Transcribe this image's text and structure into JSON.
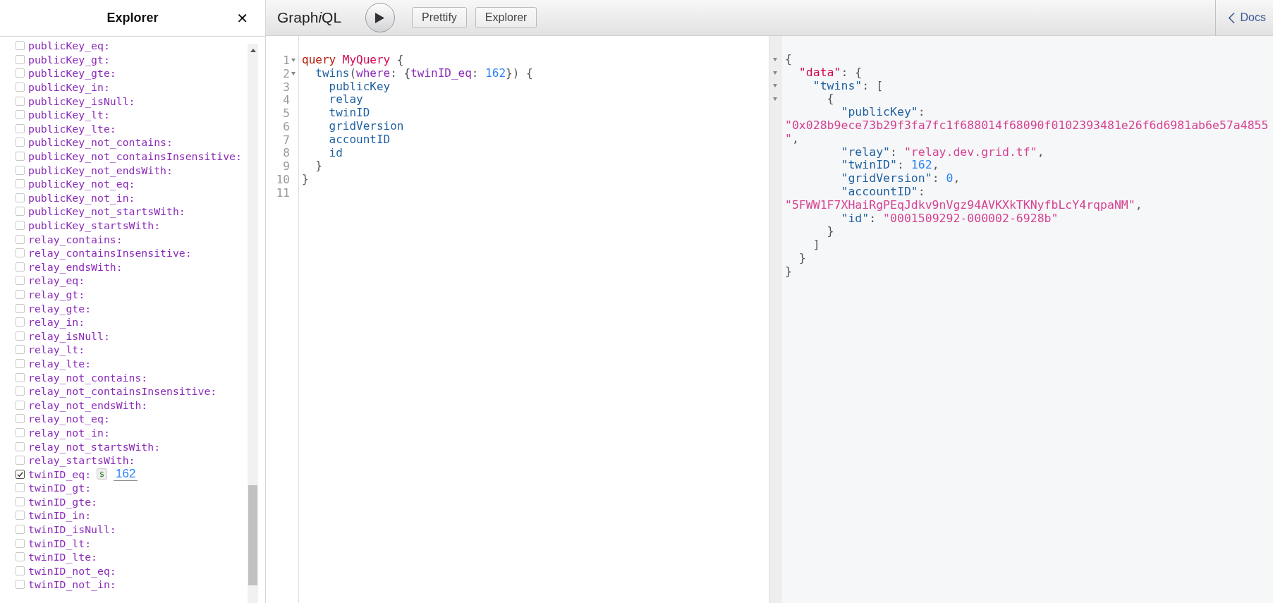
{
  "explorer": {
    "title": "Explorer",
    "close": "✕",
    "items": [
      {
        "label": "publicKey_eq:",
        "checked": false
      },
      {
        "label": "publicKey_gt:",
        "checked": false
      },
      {
        "label": "publicKey_gte:",
        "checked": false
      },
      {
        "label": "publicKey_in:",
        "checked": false
      },
      {
        "label": "publicKey_isNull:",
        "checked": false
      },
      {
        "label": "publicKey_lt:",
        "checked": false
      },
      {
        "label": "publicKey_lte:",
        "checked": false
      },
      {
        "label": "publicKey_not_contains:",
        "checked": false
      },
      {
        "label": "publicKey_not_containsInsensitive:",
        "checked": false
      },
      {
        "label": "publicKey_not_endsWith:",
        "checked": false
      },
      {
        "label": "publicKey_not_eq:",
        "checked": false
      },
      {
        "label": "publicKey_not_in:",
        "checked": false
      },
      {
        "label": "publicKey_not_startsWith:",
        "checked": false
      },
      {
        "label": "publicKey_startsWith:",
        "checked": false
      },
      {
        "label": "relay_contains:",
        "checked": false
      },
      {
        "label": "relay_containsInsensitive:",
        "checked": false
      },
      {
        "label": "relay_endsWith:",
        "checked": false
      },
      {
        "label": "relay_eq:",
        "checked": false
      },
      {
        "label": "relay_gt:",
        "checked": false
      },
      {
        "label": "relay_gte:",
        "checked": false
      },
      {
        "label": "relay_in:",
        "checked": false
      },
      {
        "label": "relay_isNull:",
        "checked": false
      },
      {
        "label": "relay_lt:",
        "checked": false
      },
      {
        "label": "relay_lte:",
        "checked": false
      },
      {
        "label": "relay_not_contains:",
        "checked": false
      },
      {
        "label": "relay_not_containsInsensitive:",
        "checked": false
      },
      {
        "label": "relay_not_endsWith:",
        "checked": false
      },
      {
        "label": "relay_not_eq:",
        "checked": false
      },
      {
        "label": "relay_not_in:",
        "checked": false
      },
      {
        "label": "relay_not_startsWith:",
        "checked": false
      },
      {
        "label": "relay_startsWith:",
        "checked": false
      },
      {
        "label": "twinID_eq:",
        "checked": true,
        "variable": "$",
        "value": "162"
      },
      {
        "label": "twinID_gt:",
        "checked": false
      },
      {
        "label": "twinID_gte:",
        "checked": false
      },
      {
        "label": "twinID_in:",
        "checked": false
      },
      {
        "label": "twinID_isNull:",
        "checked": false
      },
      {
        "label": "twinID_lt:",
        "checked": false
      },
      {
        "label": "twinID_lte:",
        "checked": false
      },
      {
        "label": "twinID_not_eq:",
        "checked": false
      },
      {
        "label": "twinID_not_in:",
        "checked": false
      }
    ]
  },
  "toolbar": {
    "logo": {
      "head": "Graph",
      "emphasis": "i",
      "tail": "QL"
    },
    "buttons": [
      "Prettify",
      "Explorer"
    ],
    "docs": "Docs"
  },
  "editor": {
    "lines": [
      {
        "n": "1",
        "fold": true,
        "tokens": [
          {
            "t": "query ",
            "kind": "keyword"
          },
          {
            "t": "MyQuery",
            "kind": "def"
          },
          {
            "t": " {",
            "kind": "punct"
          }
        ]
      },
      {
        "n": "2",
        "fold": true,
        "tokens": [
          {
            "t": "  twins",
            "kind": "property"
          },
          {
            "t": "(",
            "kind": "punct"
          },
          {
            "t": "where",
            "kind": "attribute"
          },
          {
            "t": ": {",
            "kind": "punct"
          },
          {
            "t": "twinID_eq",
            "kind": "attribute"
          },
          {
            "t": ": ",
            "kind": "punct"
          },
          {
            "t": "162",
            "kind": "number"
          },
          {
            "t": "}) {",
            "kind": "punct"
          }
        ]
      },
      {
        "n": "3",
        "fold": false,
        "tokens": [
          {
            "t": "    publicKey",
            "kind": "property"
          }
        ]
      },
      {
        "n": "4",
        "fold": false,
        "tokens": [
          {
            "t": "    relay",
            "kind": "property"
          }
        ]
      },
      {
        "n": "5",
        "fold": false,
        "tokens": [
          {
            "t": "    twinID",
            "kind": "property"
          }
        ]
      },
      {
        "n": "6",
        "fold": false,
        "tokens": [
          {
            "t": "    gridVersion",
            "kind": "property"
          }
        ]
      },
      {
        "n": "7",
        "fold": false,
        "tokens": [
          {
            "t": "    accountID",
            "kind": "property"
          }
        ]
      },
      {
        "n": "8",
        "fold": false,
        "tokens": [
          {
            "t": "    id",
            "kind": "property"
          }
        ]
      },
      {
        "n": "9",
        "fold": false,
        "tokens": [
          {
            "t": "  }",
            "kind": "punct"
          }
        ]
      },
      {
        "n": "10",
        "fold": false,
        "tokens": [
          {
            "t": "}",
            "kind": "punct"
          }
        ]
      },
      {
        "n": "11",
        "fold": false
      }
    ]
  },
  "result": {
    "lines": [
      {
        "fold": true,
        "tokens": [
          {
            "t": "{",
            "kind": "punct"
          }
        ]
      },
      {
        "fold": true,
        "tokens": [
          {
            "t": "  \"data\"",
            "kind": "def"
          },
          {
            "t": ": {",
            "kind": "punct"
          }
        ]
      },
      {
        "fold": true,
        "tokens": [
          {
            "t": "    \"twins\"",
            "kind": "property"
          },
          {
            "t": ": [",
            "kind": "punct"
          }
        ]
      },
      {
        "fold": true,
        "tokens": [
          {
            "t": "      {",
            "kind": "punct"
          }
        ]
      },
      {
        "fold": false,
        "tokens": [
          {
            "t": "        \"publicKey\"",
            "kind": "property"
          },
          {
            "t": ":",
            "kind": "punct"
          }
        ]
      },
      {
        "fold": false,
        "tokens": [
          {
            "t": "\"0x028b9ece73b29f3fa7fc1f688014f68090f0102393481e26f6d6981ab6e57a4855",
            "kind": "string"
          }
        ]
      },
      {
        "fold": false,
        "tokens": [
          {
            "t": "\"",
            "kind": "string"
          },
          {
            "t": ",",
            "kind": "punct"
          }
        ]
      },
      {
        "fold": false,
        "tokens": [
          {
            "t": "        \"relay\"",
            "kind": "property"
          },
          {
            "t": ": ",
            "kind": "punct"
          },
          {
            "t": "\"relay.dev.grid.tf\"",
            "kind": "string"
          },
          {
            "t": ",",
            "kind": "punct"
          }
        ]
      },
      {
        "fold": false,
        "tokens": [
          {
            "t": "        \"twinID\"",
            "kind": "property"
          },
          {
            "t": ": ",
            "kind": "punct"
          },
          {
            "t": "162",
            "kind": "number"
          },
          {
            "t": ",",
            "kind": "punct"
          }
        ]
      },
      {
        "fold": false,
        "tokens": [
          {
            "t": "        \"gridVersion\"",
            "kind": "property"
          },
          {
            "t": ": ",
            "kind": "punct"
          },
          {
            "t": "0",
            "kind": "number"
          },
          {
            "t": ",",
            "kind": "punct"
          }
        ]
      },
      {
        "fold": false,
        "tokens": [
          {
            "t": "        \"accountID\"",
            "kind": "property"
          },
          {
            "t": ":",
            "kind": "punct"
          }
        ]
      },
      {
        "fold": false,
        "tokens": [
          {
            "t": "\"5FWW1F7XHaiRgPEqJdkv9nVgz94AVKXkTKNyfbLcY4rqpaNM\"",
            "kind": "string"
          },
          {
            "t": ",",
            "kind": "punct"
          }
        ]
      },
      {
        "fold": false,
        "tokens": [
          {
            "t": "        \"id\"",
            "kind": "property"
          },
          {
            "t": ": ",
            "kind": "punct"
          },
          {
            "t": "\"0001509292-000002-6928b\"",
            "kind": "string"
          }
        ]
      },
      {
        "fold": false,
        "tokens": [
          {
            "t": "      }",
            "kind": "punct"
          }
        ]
      },
      {
        "fold": false,
        "tokens": [
          {
            "t": "    ]",
            "kind": "punct"
          }
        ]
      },
      {
        "fold": false,
        "tokens": [
          {
            "t": "  }",
            "kind": "punct"
          }
        ]
      },
      {
        "fold": false,
        "tokens": [
          {
            "t": "}",
            "kind": "punct"
          }
        ]
      }
    ]
  }
}
